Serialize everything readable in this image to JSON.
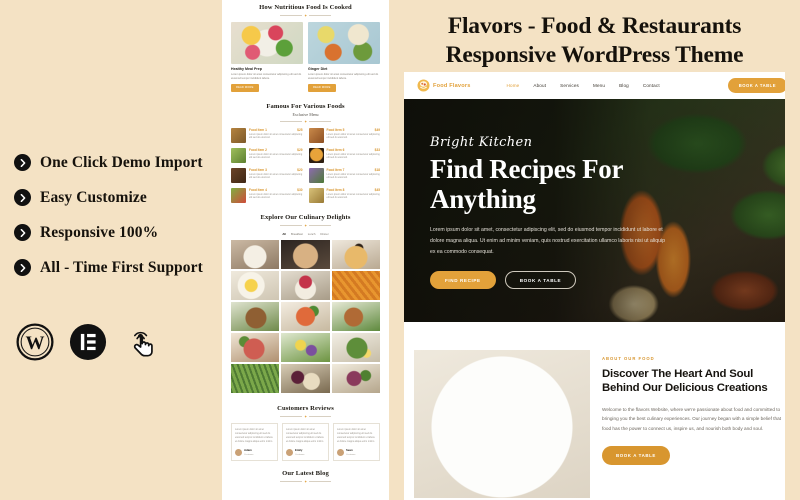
{
  "colors": {
    "background": "#f4e2c4",
    "accent": "#e2a13a",
    "accent_dark": "#d8962f",
    "text_dark": "#15110b",
    "panel": "#ffffff"
  },
  "promo": {
    "features": [
      {
        "label": "One Click Demo Import"
      },
      {
        "label": "Easy Customize"
      },
      {
        "label": "Responsive 100%"
      },
      {
        "label": "All - Time First Support"
      }
    ],
    "brand_icons": [
      {
        "name": "wordpress-icon",
        "title": "WordPress"
      },
      {
        "name": "elementor-icon",
        "title": "Elementor"
      },
      {
        "name": "click-hand-icon",
        "title": "One Click"
      }
    ]
  },
  "title": {
    "line1": "Flavors - Food & Restaurants",
    "line2": "Responsive WordPress Theme"
  },
  "site": {
    "logo": "Food Flavors",
    "nav": [
      {
        "label": "Home",
        "active": true
      },
      {
        "label": "About",
        "active": false
      },
      {
        "label": "Services",
        "active": false
      },
      {
        "label": "Menu",
        "active": false
      },
      {
        "label": "Blog",
        "active": false
      },
      {
        "label": "Contact",
        "active": false
      }
    ],
    "nav_cta": "BOOK A TABLE",
    "hero": {
      "script": "Bright Kitchen",
      "heading": "Find Recipes For Anything",
      "paragraph": "Lorem ipsum dolor sit amet, consectetur adipiscing elit, sed do eiusmod tempor incididunt ut labore et dolore magna aliqua. Ut enim ad minim veniam, quis nostrud exercitation ullamco laboris nisi ut aliquip ex ea commodo consequat.",
      "btn_primary": "FIND RECIPE",
      "btn_secondary": "BOOK A TABLE"
    },
    "about": {
      "eyebrow": "ABOUT OUR FOOD",
      "heading": "Discover The Heart And Soul Behind Our Delicious Creations",
      "paragraph": "Welcome to the flavors Website, where we're passionate about food and committed to bringing you the best culinary experiences. Our journey began with a simple belief that food has the power to connect us, inspire us, and nourish both body and soul.",
      "button": "BOOK A TABLE"
    }
  },
  "preview": {
    "section_cooked": {
      "title": "How Nutritious Food Is Cooked",
      "cards": [
        {
          "title": "Healthy Meal Prep",
          "text": "Lorem ipsum dolor sit amet consectetur adipiscing elit sed do eiusmod tempor incididunt labore.",
          "button": "READ MORE"
        },
        {
          "title": "Ginger Diet",
          "text": "Lorem ipsum dolor sit amet consectetur adipiscing elit sed do eiusmod tempor incididunt labore.",
          "button": "READ MORE"
        }
      ]
    },
    "section_menu": {
      "title": "Famous For Various Foods",
      "subtitle": "Exclusive Menu",
      "items_left": [
        {
          "name": "Food Item 1",
          "price": "$25",
          "desc": "Lorem ipsum dolor sit amet consectetur adipiscing elit sed do eiusmod."
        },
        {
          "name": "Food Item 2",
          "price": "$29",
          "desc": "Lorem ipsum dolor sit amet consectetur adipiscing elit sed do eiusmod."
        },
        {
          "name": "Food Item 3",
          "price": "$20",
          "desc": "Lorem ipsum dolor sit amet consectetur adipiscing elit sed do eiusmod."
        },
        {
          "name": "Food Item 4",
          "price": "$30",
          "desc": "Lorem ipsum dolor sit amet consectetur adipiscing elit sed do eiusmod."
        }
      ],
      "items_right": [
        {
          "name": "Food Item 5",
          "price": "$49",
          "desc": "Lorem ipsum dolor sit amet consectetur adipiscing elit sed do eiusmod."
        },
        {
          "name": "Food Item 6",
          "price": "$33",
          "desc": "Lorem ipsum dolor sit amet consectetur adipiscing elit sed do eiusmod."
        },
        {
          "name": "Food Item 7",
          "price": "$18",
          "desc": "Lorem ipsum dolor sit amet consectetur adipiscing elit sed do eiusmod."
        },
        {
          "name": "Food Item 8",
          "price": "$45",
          "desc": "Lorem ipsum dolor sit amet consectetur adipiscing elit sed do eiusmod."
        }
      ]
    },
    "section_gallery": {
      "title": "Explore Our Culinary Delights",
      "filters": [
        {
          "label": "All",
          "active": true
        },
        {
          "label": "Breakfast",
          "active": false
        },
        {
          "label": "Lunch",
          "active": false
        },
        {
          "label": "Dinner",
          "active": false
        }
      ]
    },
    "section_reviews": {
      "title": "Customers Reviews",
      "cards": [
        {
          "text": "Lorem ipsum dolor sit amet consectetur adipiscing elit sed do eiusmod tempor incididunt ut labore et dolore magna aliqua enim minim.",
          "name": "Adam",
          "role": "Customer"
        },
        {
          "text": "Lorem ipsum dolor sit amet consectetur adipiscing elit sed do eiusmod tempor incididunt ut labore et dolore magna aliqua enim minim.",
          "name": "Emily",
          "role": "Customer"
        },
        {
          "text": "Lorem ipsum dolor sit amet consectetur adipiscing elit sed do eiusmod tempor incididunt ut labore et dolore magna aliqua enim minim.",
          "name": "Sean",
          "role": "Customer"
        }
      ]
    },
    "section_blog": {
      "title": "Our Latest Blog"
    }
  }
}
